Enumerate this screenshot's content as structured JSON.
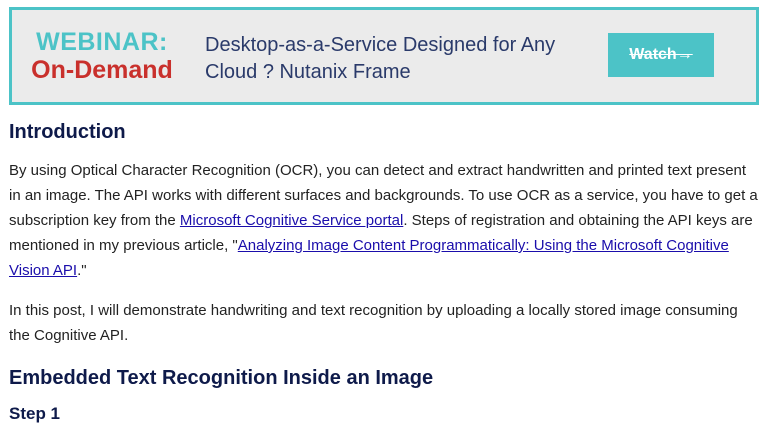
{
  "banner": {
    "label_top": "WEBINAR:",
    "label_bottom": "On-Demand",
    "title": "Desktop-as-a-Service Designed for Any Cloud ? Nutanix Frame",
    "button_label": "Watch→",
    "colors": {
      "accent": "#4cc3c7",
      "highlight": "#c9302c",
      "background": "#ebebeb"
    }
  },
  "article": {
    "intro_heading": "Introduction",
    "para1": {
      "text1": "By using Optical Character Recognition (OCR), you can detect and extract handwritten and printed text present in an image. The API works with different surfaces and backgrounds. To use OCR as a service, you have to get a subscription key from the ",
      "link1": "Microsoft Cognitive Service portal",
      "text2": ". Steps of registration and obtaining the API keys are mentioned in my previous article, \"",
      "link2": "Analyzing Image Content Programmatically: Using the Microsoft Cognitive Vision API",
      "text3": ".\""
    },
    "para2": "In this post, I will demonstrate handwriting and text recognition by uploading a locally stored image consuming the Cognitive API.",
    "section_heading": "Embedded Text Recognition Inside an Image",
    "step_heading": "Step 1"
  }
}
